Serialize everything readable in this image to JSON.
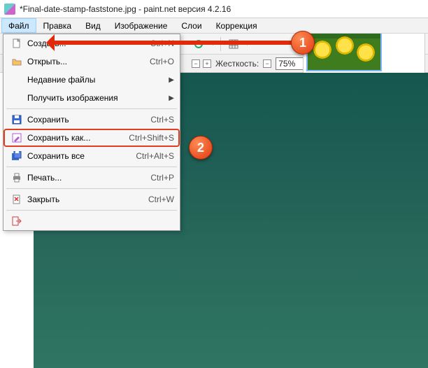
{
  "title": "*Final-date-stamp-faststone.jpg - paint.net версия 4.2.16",
  "menubar": [
    "Файл",
    "Правка",
    "Вид",
    "Изображение",
    "Слои",
    "Коррекция"
  ],
  "optbar": {
    "hardness_label": "Жесткость:",
    "hardness_value": "75%"
  },
  "dropdown": {
    "items": [
      {
        "label": "Создать...",
        "shortcut": "Ctrl+N",
        "icon": "new"
      },
      {
        "label": "Открыть...",
        "shortcut": "Ctrl+O",
        "icon": "open"
      },
      {
        "label": "Недавние файлы",
        "submenu": true
      },
      {
        "label": "Получить изображения",
        "submenu": true
      },
      {
        "sep": true
      },
      {
        "label": "Сохранить",
        "shortcut": "Ctrl+S",
        "icon": "save"
      },
      {
        "label": "Сохранить как...",
        "shortcut": "Ctrl+Shift+S",
        "icon": "saveas",
        "hi": true
      },
      {
        "label": "Сохранить все",
        "shortcut": "Ctrl+Alt+S",
        "icon": "saveall"
      },
      {
        "sep": true
      },
      {
        "label": "Печать...",
        "shortcut": "Ctrl+P",
        "icon": "print"
      },
      {
        "sep": true
      },
      {
        "label": "Закрыть",
        "shortcut": "Ctrl+W",
        "icon": "close"
      },
      {
        "sep": true
      },
      {
        "label": "Выход",
        "icon": "exit"
      }
    ]
  },
  "markers": {
    "m1": "1",
    "m2": "2"
  }
}
